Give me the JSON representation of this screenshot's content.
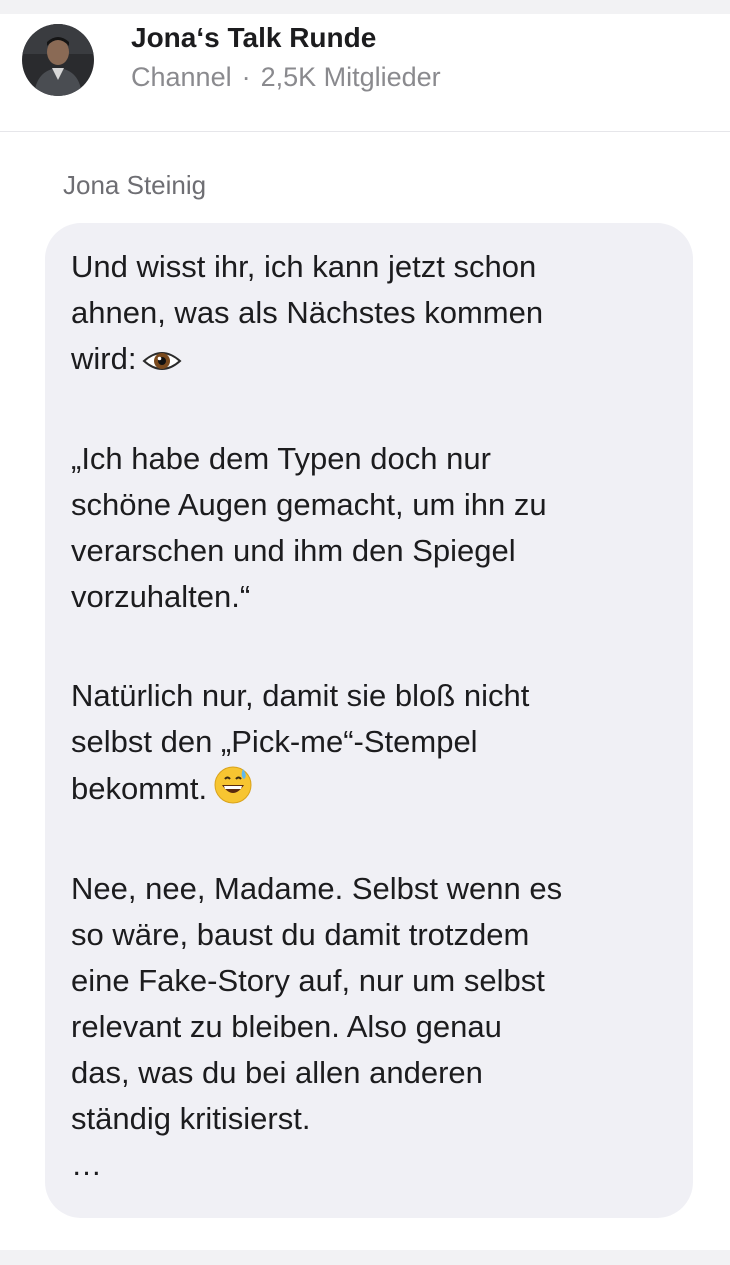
{
  "channel": {
    "name": "Jona‘s Talk Runde",
    "type": "Channel",
    "separator": "·",
    "members": "2,5K Mitglieder"
  },
  "message": {
    "sender": "Jona Steinig",
    "paragraphs": [
      {
        "lines": [
          "Und wisst ihr, ich kann jetzt schon",
          "ahnen, was als Nächstes kommen",
          "wird:"
        ],
        "trailing_icon": "eye-emoji"
      },
      {
        "lines": [
          "„Ich habe dem Typen doch nur",
          "schöne Augen gemacht, um ihn zu",
          "verarschen und ihm den Spiegel",
          "vorzuhalten.“"
        ]
      },
      {
        "lines": [
          "Natürlich nur, damit sie bloß nicht",
          "selbst den „Pick-me“-Stempel",
          "bekommt."
        ],
        "trailing_icon": "grinning-sweat-emoji"
      },
      {
        "lines": [
          "Nee, nee, Madame. Selbst wenn es",
          "so wäre, baust du damit trotzdem",
          "eine Fake-Story auf, nur um selbst",
          "relevant zu bleiben. Also genau",
          "das, was du bei allen anderen",
          "ständig kritisierst."
        ]
      }
    ],
    "ellipsis": "…"
  },
  "colors": {
    "bubble": "#f0f0f5",
    "secondary_text": "#8a8a8e",
    "sender_text": "#6e6e73"
  }
}
